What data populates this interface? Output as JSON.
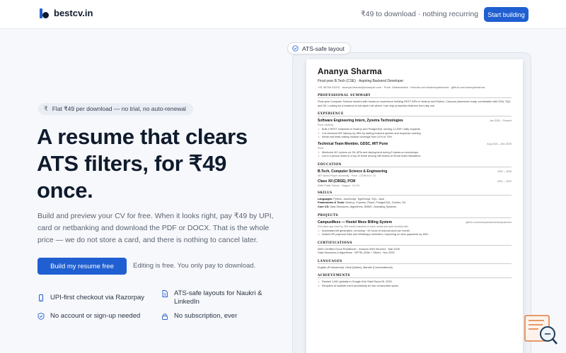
{
  "header": {
    "brand": "bestcv.in",
    "note": "₹49 to download · nothing recurring",
    "cta": "Start building"
  },
  "hero": {
    "badge": "Flat ₹49 per download — no trial, no auto-renewal",
    "title": "A resume that clears ATS filters, for ₹49 once.",
    "description": "Build and preview your CV for free. When it looks right, pay ₹49 by UPI, card or netbanking and download the PDF or DOCX. That is the whole price — we do not store a card, and there is nothing to cancel later.",
    "cta": "Build my resume free",
    "cta_note": "Editing is free. You only pay to download."
  },
  "features": [
    {
      "icon": "phone-icon",
      "label": "UPI-first checkout via Razorpay"
    },
    {
      "icon": "document-icon",
      "label": "ATS-safe layouts for Naukri & LinkedIn"
    },
    {
      "icon": "shield-check-icon",
      "label": "No account or sign-up needed"
    },
    {
      "icon": "lock-icon",
      "label": "No subscription, ever"
    }
  ],
  "preview": {
    "pill": "ATS-safe layout",
    "resume": {
      "name": "Ananya Sharma",
      "role": "Final-year B.Tech (CSE) · Aspiring Backend Developer",
      "contact": "+91 98765 43210 · ananya.sharma@example.com · Pune, Maharashtra · linkedin.com/in/ananyasharma · github.com/ananyasharma",
      "summary_title": "PROFESSIONAL SUMMARY",
      "summary": "Final-year Computer Science student with hands-on experience building REST APIs in Node.js and Python. Campus placement ready, comfortable with DSA, SQL and Git. Looking for a backend or full-stack role where I can ship production features from day one.",
      "experience_title": "EXPERIENCE",
      "experience": [
        {
          "title": "Software Engineering Intern, Zynetra Technologies",
          "date": "Jan 2026 – Present",
          "sub": "Pune (Hybrid)",
          "bullets": [
            "Built 4 REST endpoints in Node.js and PostgreSQL serving 12,000+ daily requests.",
            "Cut checkout API latency by 38% by adding indexed queries and response caching.",
            "Wrote unit tests raising module coverage from 41% to 79%."
          ]
        },
        {
          "title": "Technical Team Member, GDSC, MIT Pune",
          "date": "Aug 2024 – Dec 2025",
          "sub": "Pune",
          "bullets": [
            "Mentored 40+ juniors on Git, APIs and deployment during 5 hands-on workshops.",
            "Led a 4-person team to a top-10 finish among 180 teams at Smart India Hackathon."
          ]
        }
      ],
      "education_title": "EDUCATION",
      "education": [
        {
          "title": "B.Tech, Computer Science & Engineering",
          "date": "2022 – 2026",
          "sub": "MIT World Peace University · Pune · CGPA 8.6 / 10"
        },
        {
          "title": "Class XII (CBSE), PCM",
          "date": "2021 – 2022",
          "sub": "Delhi Public School · Nagpur · 91.4%"
        }
      ],
      "skills_title": "SKILLS",
      "skills": [
        {
          "label": "Languages:",
          "value": "Python, JavaScript, TypeScript, SQL, Java"
        },
        {
          "label": "Frameworks & Tools:",
          "value": "Node.js, Express, React, PostgreSQL, Docker, Git"
        },
        {
          "label": "Core CS:",
          "value": "Data Structures, Algorithms, DBMS, Operating Systems"
        }
      ],
      "projects_title": "PROJECTS",
      "project": {
        "title": "CampusMess — Hostel Mess Billing System",
        "link": "github.com/ananyasharma/campusmess",
        "sub": "Full-stack app used by 300 hostel residents to track meals and split monthly bills.",
        "bullets": [
          "Automated bill generation, removing ~10 hours of manual work per month.",
          "Added UPI payment links and WhatsApp reminders, improving on-time payments by 45%."
        ]
      },
      "certifications_title": "CERTIFICATIONS",
      "certifications": [
        "AWS Certified Cloud Practitioner · Amazon Web Services · Mar 2026",
        "Data Structures & Algorithms · NPTEL (Elite + Silver) · Nov 2025"
      ],
      "languages_title": "LANGUAGES",
      "languages": "English (Professional), Hindi (Native), Marathi (Conversational)",
      "achievements_title": "ACHIEVEMENTS",
      "achievements": [
        "Ranked 1,842 globally in Google Kick Start Round B, 2025.",
        "Recipient of institute merit scholarship for two consecutive years."
      ]
    }
  },
  "colors": {
    "accent": "#1f5fd1",
    "text": "#0f1b2d",
    "muted": "#5b6472"
  }
}
